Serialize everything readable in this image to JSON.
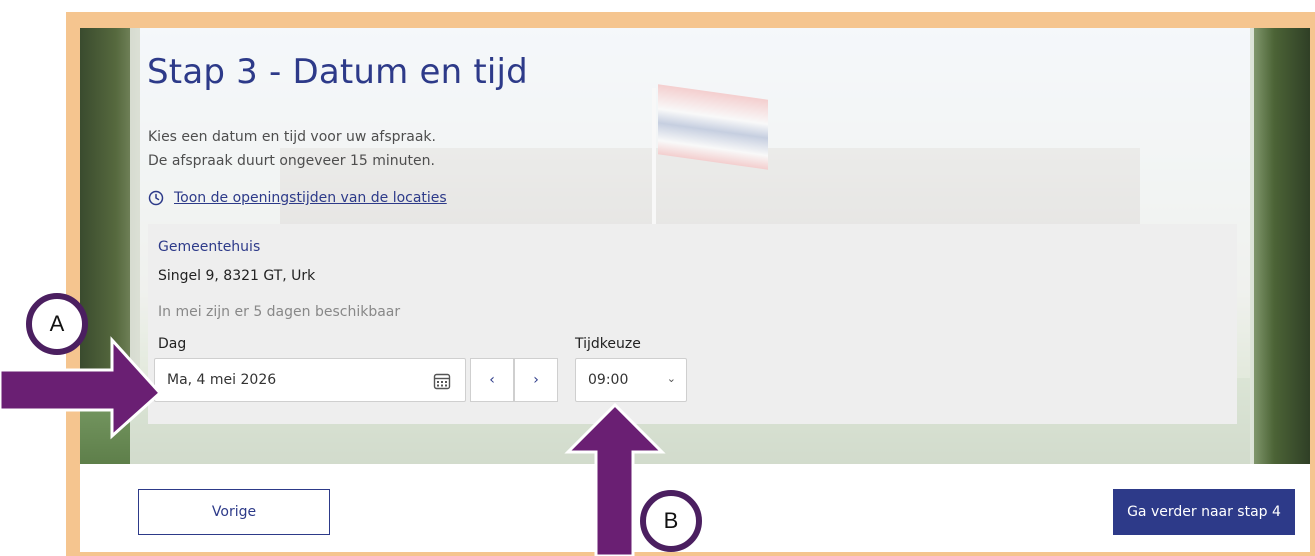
{
  "page": {
    "title": "Stap 3 - Datum en tijd",
    "intro_line1": "Kies een datum en tijd voor uw afspraak.",
    "intro_line2": "De afspraak duurt ongeveer 15 minuten.",
    "hours_link": "Toon de openingstijden van de locaties"
  },
  "location": {
    "name": "Gemeentehuis",
    "address": "Singel 9, 8321 GT, Urk",
    "availability": "In mei zijn er 5 dagen beschikbaar"
  },
  "form": {
    "day_label": "Dag",
    "day_value": "Ma, 4 mei 2026",
    "prev_label": "‹",
    "next_label": "›",
    "time_label": "Tijdkeuze",
    "time_value": "09:00"
  },
  "buttons": {
    "back": "Vorige",
    "next": "Ga verder naar stap 4"
  },
  "annotations": {
    "a": "A",
    "b": "B"
  },
  "colors": {
    "primary": "#2d3a89",
    "annotation": "#4b1f60",
    "frame": "#f5c58f"
  }
}
